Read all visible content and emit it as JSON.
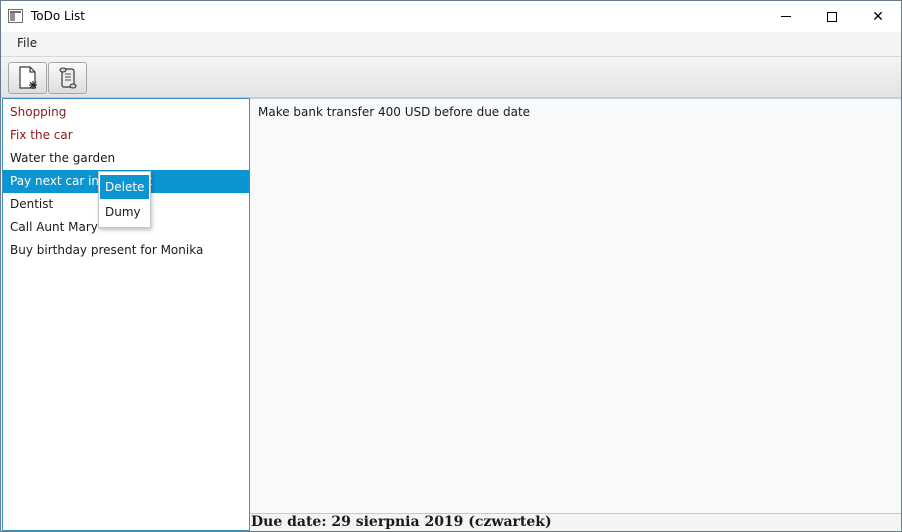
{
  "window": {
    "title": "ToDo List",
    "close_glyph": "✕"
  },
  "menubar": {
    "items": [
      {
        "label": "File"
      }
    ]
  },
  "toolbar": {
    "buttons": [
      {
        "icon": "new-document-icon"
      },
      {
        "icon": "scroll-details-icon"
      }
    ]
  },
  "todo_list": {
    "items": [
      {
        "label": "Shopping",
        "state": "overdue"
      },
      {
        "label": "Fix the car",
        "state": "overdue"
      },
      {
        "label": "Water the garden",
        "state": "normal"
      },
      {
        "label": "Pay next car instalment",
        "state": "selected"
      },
      {
        "label": "Dentist",
        "state": "normal"
      },
      {
        "label": "Call Aunt Mary",
        "state": "normal"
      },
      {
        "label": "Buy birthday present for Monika",
        "state": "normal"
      }
    ]
  },
  "context_menu": {
    "items": [
      {
        "label": "Delete",
        "state": "active"
      },
      {
        "label": "Dumy",
        "state": "normal"
      }
    ]
  },
  "details": {
    "text": "Make bank transfer 400 USD before due date",
    "due_date": "Due date: 29 sierpnia 2019 (czwartek)"
  },
  "colors": {
    "selection": "#0b96d2",
    "overdue_text": "#8b1a1a",
    "list_border": "#3d8fc6"
  }
}
